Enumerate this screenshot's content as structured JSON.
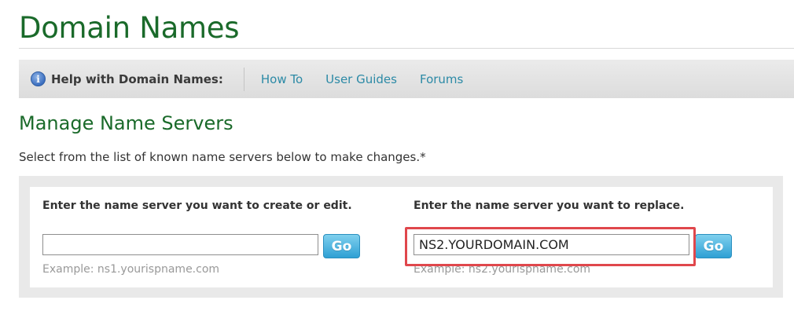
{
  "page": {
    "title": "Domain Names"
  },
  "help_bar": {
    "icon": "info-icon",
    "label": "Help with Domain Names:",
    "links": [
      "How To",
      "User Guides",
      "Forums"
    ]
  },
  "section": {
    "title": "Manage Name Servers",
    "description": "Select from the list of known name servers below to make changes.*"
  },
  "form": {
    "create": {
      "label": "Enter the name server you want to create or edit.",
      "value": "",
      "button": "Go",
      "example": "Example: ns1.yourispname.com"
    },
    "replace": {
      "label": "Enter the name server you want to replace.",
      "value": "NS2.YOURDOMAIN.COM",
      "button": "Go",
      "example": "Example: ns2.yourispname.com"
    }
  },
  "colors": {
    "title_green": "#1a6a2a",
    "link_blue": "#2c8aa6",
    "button_blue": "#2ea0d4",
    "highlight_red": "#e0474c"
  }
}
